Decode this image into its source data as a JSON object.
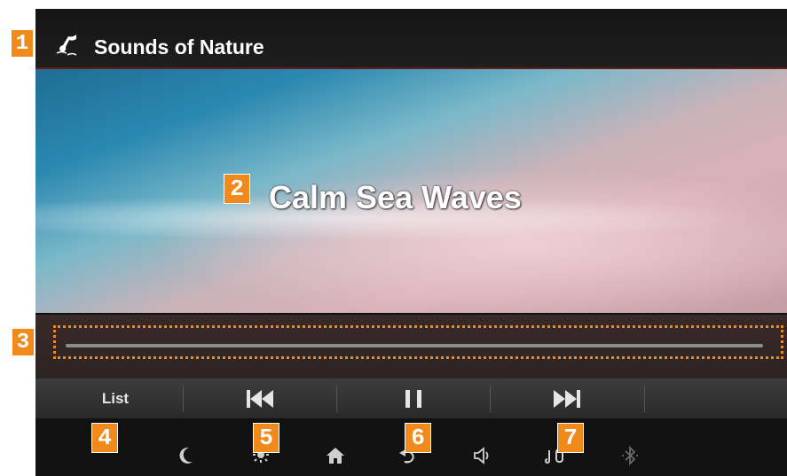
{
  "app_title": "Sounds of Nature",
  "track_title": "Calm Sea Waves",
  "controls": {
    "list_label": "List",
    "prev_icon": "previous-track-icon",
    "pause_icon": "pause-icon",
    "next_icon": "next-track-icon"
  },
  "progress": {
    "fraction": 0.0
  },
  "status_icons": [
    "moon-icon",
    "brightness-icon",
    "home-icon",
    "back-icon",
    "volume-icon",
    "media-source-icon",
    "bluetooth-icon"
  ],
  "callouts": {
    "c1": "1",
    "c2": "2",
    "c3": "3",
    "c4": "4",
    "c5": "5",
    "c6": "6",
    "c7": "7"
  },
  "colors": {
    "callout": "#f08a1c",
    "title_bar": "#1a1a1a",
    "control_bar": "#333333"
  }
}
